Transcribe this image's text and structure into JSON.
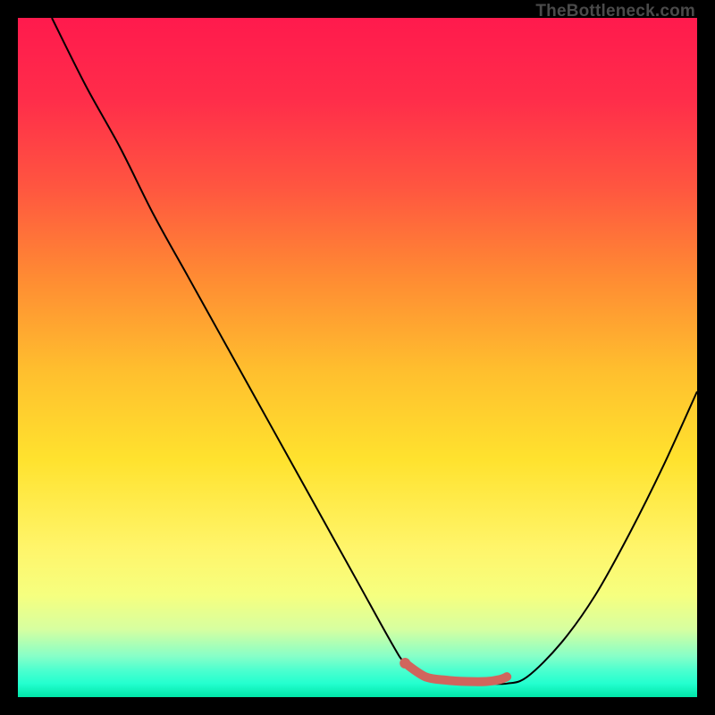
{
  "watermark": "TheBottleneck.com",
  "colors": {
    "curve": "#000000",
    "marker_stroke": "#d0655d",
    "marker_fill": "#d0655d",
    "frame": "#000000"
  },
  "chart_data": {
    "type": "line",
    "title": "",
    "xlabel": "",
    "ylabel": "",
    "xlim": [
      0,
      100
    ],
    "ylim": [
      0,
      100
    ],
    "series": [
      {
        "name": "curve",
        "x": [
          5,
          10,
          15,
          20,
          25,
          30,
          35,
          40,
          45,
          50,
          55,
          57,
          60,
          65,
          69,
          72,
          75,
          80,
          85,
          90,
          95,
          100
        ],
        "y": [
          100,
          90,
          81,
          71,
          62,
          53,
          44,
          35,
          26,
          17,
          8,
          5,
          3,
          2,
          2,
          2,
          3,
          8,
          15,
          24,
          34,
          45
        ]
      },
      {
        "name": "highlight",
        "x": [
          57,
          60,
          63,
          66,
          69,
          71,
          72
        ],
        "y": [
          5,
          3,
          2.5,
          2.3,
          2.3,
          2.6,
          3
        ]
      }
    ],
    "marker_point": {
      "x": 57,
      "y": 5
    }
  }
}
